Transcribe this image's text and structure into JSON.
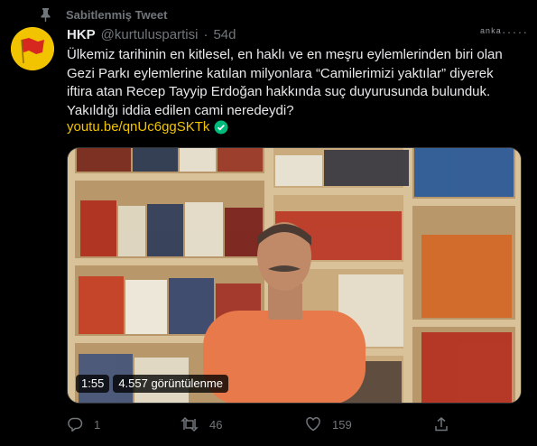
{
  "pinned": {
    "label": "Sabitlenmiş Tweet"
  },
  "watermark": "anka.....",
  "author": {
    "display_name": "HKP",
    "handle": "@kurtuluspartisi",
    "separator": "·",
    "age": "54d"
  },
  "tweet": {
    "lines": [
      "Ülkemiz tarihinin en kitlesel, en haklı ve en meşru eylemlerinden biri olan",
      "Gezi Parkı eylemlerine katılan milyonlara “Camilerimizi yaktılar” diyerek",
      "iftira atan Recep Tayyip Erdoğan hakkında suç duyurusunda bulunduk.",
      "Yakıldığı iddia edilen cami neredeydi?"
    ],
    "link": "youtu.be/qnUc6ggSKTk"
  },
  "video": {
    "duration": "1:55",
    "views": "4.557 görüntülenme"
  },
  "actions": {
    "reply_count": "1",
    "retweet_count": "46",
    "like_count": "159"
  },
  "colors": {
    "background": "#000000",
    "link": "#f2c400",
    "muted": "#71767b",
    "text": "#e7e9ea",
    "verified": "#00ba7c"
  },
  "icons": {
    "pin": "pin-icon",
    "verified": "check-circle-icon",
    "reply": "reply-icon",
    "retweet": "retweet-icon",
    "like": "heart-icon",
    "share": "share-icon"
  }
}
